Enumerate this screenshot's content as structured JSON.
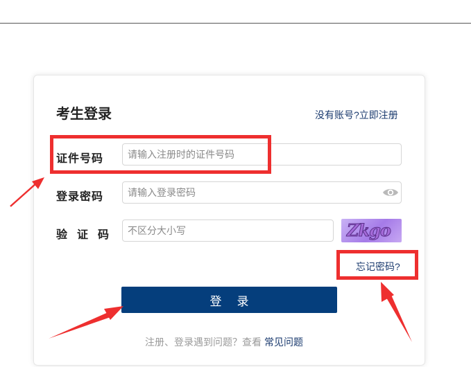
{
  "login": {
    "title": "考生登录",
    "register_link": "没有账号?立即注册",
    "id_label": "证件号码",
    "id_placeholder": "请输入注册时的证件号码",
    "password_label": "登录密码",
    "password_placeholder": "请输入登录密码",
    "captcha_label": "验证码",
    "captcha_placeholder": "不区分大小写",
    "captcha_text": "Zkgo",
    "forgot_link": "忘记密码?",
    "login_button": "登录",
    "help_text": "注册、登录遇到问题？查看",
    "faq_link": "常见问题"
  },
  "icons": {
    "password_toggle": "eye-icon"
  },
  "colors": {
    "primary": "#053e7c",
    "link": "#1a3a6e",
    "annotation": "#ee2f2f",
    "captcha_bg": "#b48cf0"
  }
}
